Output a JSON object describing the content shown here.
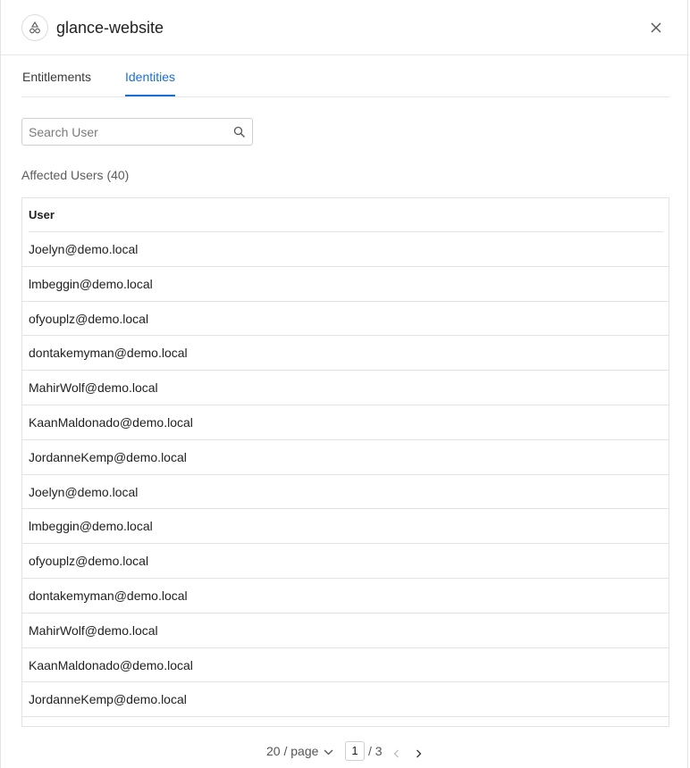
{
  "header": {
    "title": "glance-website",
    "app_icon": "shapes-icon",
    "close_icon": "close-icon"
  },
  "tabs": [
    {
      "label": "Entitlements",
      "active": false
    },
    {
      "label": "Identities",
      "active": true
    }
  ],
  "search": {
    "placeholder": "Search User",
    "value": "",
    "icon": "search-icon"
  },
  "affected_label": "Affected Users (40)",
  "table": {
    "columns": [
      "User"
    ],
    "rows": [
      "Joelyn@demo.local",
      "lmbeggin@demo.local",
      "ofyouplz@demo.local",
      "dontakemyman@demo.local",
      "MahirWolf@demo.local",
      "KaanMaldonado@demo.local",
      "JordanneKemp@demo.local",
      "Joelyn@demo.local",
      "lmbeggin@demo.local",
      "ofyouplz@demo.local",
      "dontakemyman@demo.local",
      "MahirWolf@demo.local",
      "KaanMaldonado@demo.local",
      "JordanneKemp@demo.local"
    ]
  },
  "pagination": {
    "page_size_label": "20 / page",
    "current_page": "1",
    "total_label": "/ 3"
  },
  "colors": {
    "accent": "#1a6fd6",
    "border": "#e3e3e3"
  }
}
